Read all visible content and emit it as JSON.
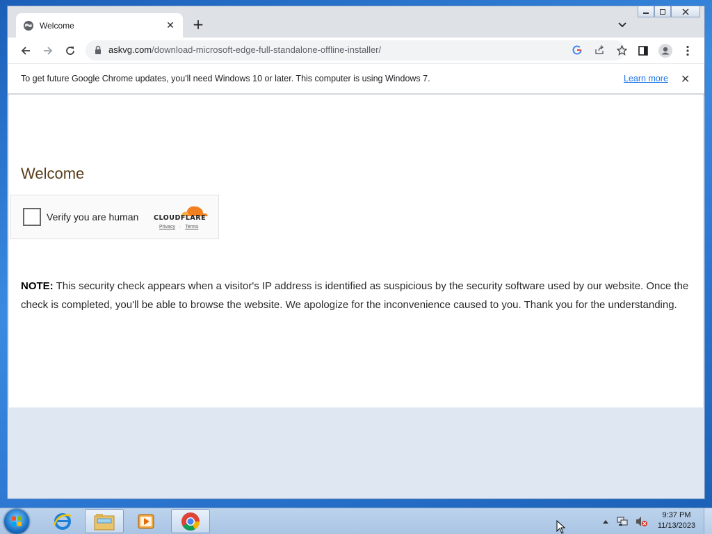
{
  "browser": {
    "tab": {
      "title": "Welcome"
    },
    "new_tab_label": "+",
    "omnibox": {
      "host": "askvg.com",
      "path": "/download-microsoft-edge-full-standalone-offline-installer/"
    },
    "infobar": {
      "message": "To get future Google Chrome updates, you'll need Windows 10 or later. This computer is using Windows 7.",
      "link": "Learn more"
    }
  },
  "page": {
    "heading": "Welcome",
    "captcha": {
      "label": "Verify you are human",
      "brand": "CLOUDFLARE",
      "privacy": "Privacy",
      "separator": "·",
      "terms": "Terms"
    },
    "note": {
      "prefix": "NOTE:",
      "text": " This security check appears when a visitor's IP address is identified as suspicious by the security software used by our website. Once the check is completed, you'll be able to browse the website. We apologize for the inconvenience caused to you. Thank you for the understanding."
    }
  },
  "taskbar": {
    "clock": {
      "time": "9:37 PM",
      "date": "11/13/2023"
    }
  },
  "colors": {
    "heading": "#5a3e1b",
    "cloudflare_orange": "#f38020",
    "link_blue": "#1a73e8"
  }
}
